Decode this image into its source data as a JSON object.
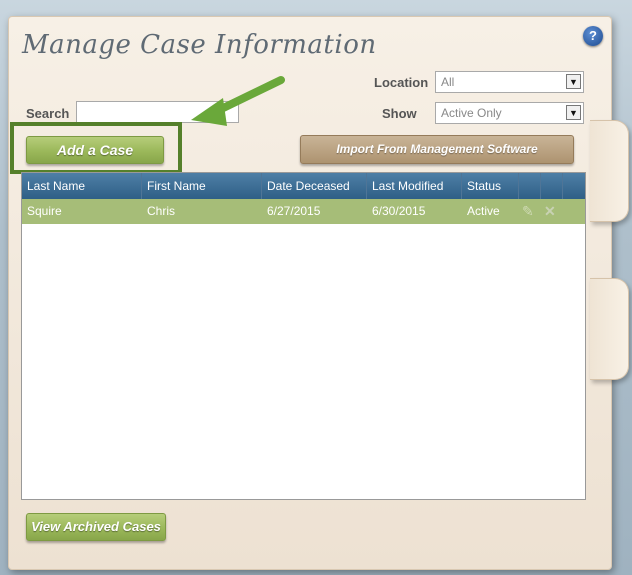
{
  "header": {
    "title": "Manage Case Information",
    "help_label": "?"
  },
  "filters": {
    "location_label": "Location",
    "location_value": "All",
    "show_label": "Show",
    "show_value": "Active Only",
    "search_label": "Search",
    "search_value": ""
  },
  "buttons": {
    "add_case": "Add a Case",
    "import": "Import From Management Software",
    "view_archived": "View Archived Cases"
  },
  "table": {
    "columns": [
      "Last Name",
      "First Name",
      "Date Deceased",
      "Last Modified",
      "Status"
    ],
    "rows": [
      {
        "last_name": "Squire",
        "first_name": "Chris",
        "date_deceased": "6/27/2015",
        "last_modified": "6/30/2015",
        "status": "Active"
      }
    ]
  },
  "icons": {
    "edit": "pencil-icon",
    "delete": "delete-x-icon",
    "dropdown": "chevron-down-icon",
    "annotation_arrow": "green-arrow-icon"
  },
  "colors": {
    "accent_green": "#9bb85a",
    "header_blue": "#3a6a91",
    "row_green": "#a6bd78",
    "highlight_box": "#55802b",
    "import_tan": "#ad9370"
  }
}
